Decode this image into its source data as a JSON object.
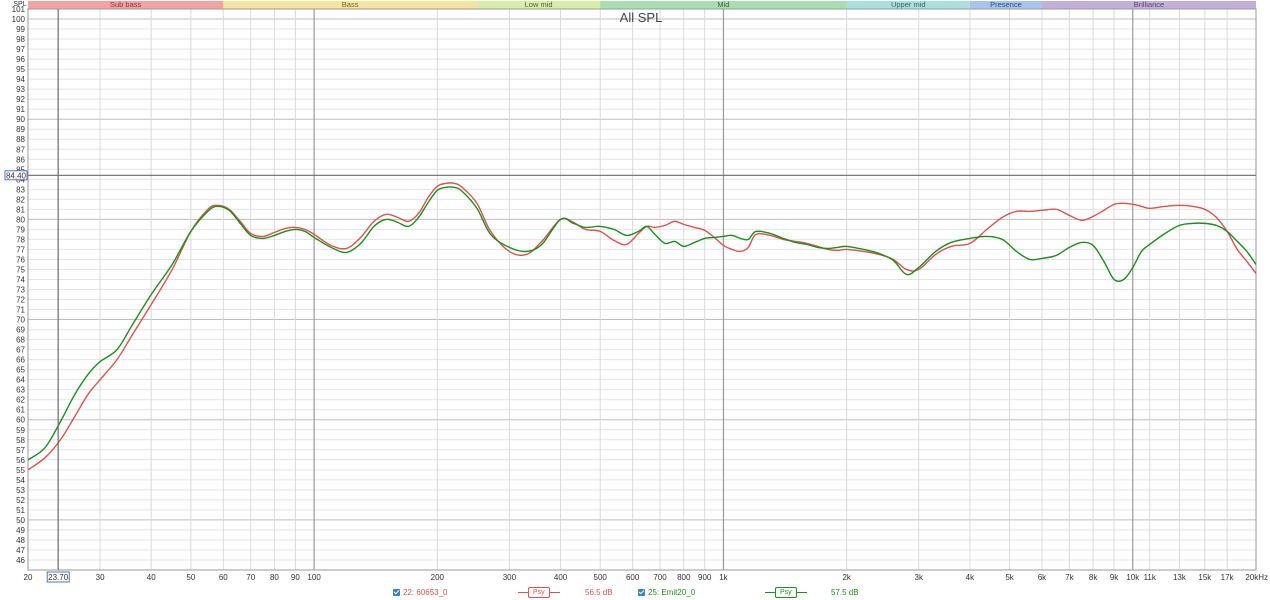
{
  "chart_data": {
    "type": "line",
    "title": "All SPL",
    "ylabel": "SPL",
    "xscale": "log",
    "xlim": [
      20,
      20000
    ],
    "ylim": [
      45,
      101
    ],
    "y_ticks": [
      46,
      47,
      48,
      49,
      50,
      51,
      52,
      53,
      54,
      55,
      56,
      57,
      58,
      59,
      60,
      61,
      62,
      63,
      64,
      65,
      66,
      67,
      68,
      69,
      70,
      71,
      72,
      73,
      74,
      75,
      76,
      77,
      78,
      79,
      80,
      81,
      82,
      83,
      84,
      85,
      86,
      87,
      88,
      89,
      90,
      91,
      92,
      93,
      94,
      95,
      96,
      97,
      98,
      99,
      100,
      101
    ],
    "x_ticks": [
      {
        "v": 20,
        "label": "20"
      },
      {
        "v": 30,
        "label": "30"
      },
      {
        "v": 40,
        "label": "40"
      },
      {
        "v": 50,
        "label": "50"
      },
      {
        "v": 60,
        "label": "60"
      },
      {
        "v": 70,
        "label": "70"
      },
      {
        "v": 80,
        "label": "80"
      },
      {
        "v": 90,
        "label": "90"
      },
      {
        "v": 100,
        "label": "100"
      },
      {
        "v": 200,
        "label": "200"
      },
      {
        "v": 300,
        "label": "300"
      },
      {
        "v": 400,
        "label": "400"
      },
      {
        "v": 500,
        "label": "500"
      },
      {
        "v": 600,
        "label": "600"
      },
      {
        "v": 700,
        "label": "700"
      },
      {
        "v": 800,
        "label": "800"
      },
      {
        "v": 900,
        "label": "900"
      },
      {
        "v": 1000,
        "label": "1k"
      },
      {
        "v": 2000,
        "label": "2k"
      },
      {
        "v": 3000,
        "label": "3k"
      },
      {
        "v": 4000,
        "label": "4k"
      },
      {
        "v": 5000,
        "label": "5k"
      },
      {
        "v": 6000,
        "label": "6k"
      },
      {
        "v": 7000,
        "label": "7k"
      },
      {
        "v": 8000,
        "label": "8k"
      },
      {
        "v": 9000,
        "label": "9k"
      },
      {
        "v": 10000,
        "label": "10k"
      },
      {
        "v": 11000,
        "label": "11k"
      },
      {
        "v": 13000,
        "label": "13k"
      },
      {
        "v": 15000,
        "label": "15k"
      },
      {
        "v": 17000,
        "label": "17k"
      },
      {
        "v": 20000,
        "label": "20kHz"
      }
    ],
    "bands": [
      {
        "name": "Sub bass",
        "from": 20,
        "to": 60,
        "color": "#f4a3a3",
        "text": "#9b3030"
      },
      {
        "name": "Bass",
        "from": 60,
        "to": 250,
        "color": "#f5e3a0",
        "text": "#7a6414"
      },
      {
        "name": "Low mid",
        "from": 250,
        "to": 500,
        "color": "#d6eeaa",
        "text": "#4b6a1e"
      },
      {
        "name": "Mid",
        "from": 500,
        "to": 2000,
        "color": "#a9deb0",
        "text": "#2d6a3a"
      },
      {
        "name": "Upper mid",
        "from": 2000,
        "to": 4000,
        "color": "#a9e0dc",
        "text": "#2a6a68"
      },
      {
        "name": "Presence",
        "from": 4000,
        "to": 6000,
        "color": "#a9c4ea",
        "text": "#2c4d7e"
      },
      {
        "name": "Brilliance",
        "from": 6000,
        "to": 20000,
        "color": "#c3b0d9",
        "text": "#54407a"
      }
    ],
    "cursor": {
      "x": 23.7,
      "y": 84.4,
      "x_label": "23.70",
      "y_label": "84.40"
    },
    "series": [
      {
        "name": "22: 60653_0",
        "color": "#d9534f",
        "x": [
          20,
          22,
          24,
          26,
          28,
          30,
          33,
          36,
          40,
          45,
          50,
          55,
          58,
          62,
          66,
          70,
          75,
          80,
          85,
          90,
          95,
          100,
          110,
          120,
          130,
          140,
          150,
          160,
          170,
          180,
          190,
          200,
          210,
          220,
          230,
          250,
          270,
          300,
          330,
          360,
          400,
          430,
          460,
          500,
          540,
          580,
          620,
          650,
          680,
          720,
          760,
          800,
          850,
          900,
          950,
          1000,
          1050,
          1100,
          1150,
          1200,
          1300,
          1400,
          1500,
          1600,
          1700,
          1800,
          1900,
          2000,
          2200,
          2400,
          2600,
          2800,
          3000,
          3300,
          3600,
          4000,
          4400,
          4800,
          5200,
          5600,
          6000,
          6500,
          7000,
          7500,
          8000,
          8500,
          9000,
          9500,
          10000,
          10500,
          11000,
          12000,
          13000,
          14000,
          15000,
          16000,
          17000,
          18000,
          19000,
          20000
        ],
        "y": [
          55.0,
          56.2,
          58.0,
          60.3,
          62.5,
          64.0,
          66.0,
          68.5,
          71.5,
          75.0,
          78.8,
          81.0,
          81.4,
          81.0,
          79.8,
          78.6,
          78.3,
          78.7,
          79.1,
          79.2,
          79.0,
          78.5,
          77.4,
          77.1,
          78.2,
          79.8,
          80.5,
          80.2,
          79.8,
          80.6,
          82.2,
          83.3,
          83.6,
          83.6,
          83.2,
          81.6,
          78.8,
          76.8,
          76.5,
          77.8,
          80.0,
          79.7,
          79.0,
          78.8,
          77.9,
          77.5,
          78.6,
          79.3,
          79.2,
          79.4,
          79.8,
          79.5,
          79.2,
          78.9,
          78.2,
          77.4,
          77.0,
          76.8,
          77.2,
          78.5,
          78.4,
          78.0,
          77.8,
          77.6,
          77.3,
          77.0,
          76.9,
          77.0,
          76.8,
          76.5,
          76.0,
          75.0,
          75.0,
          76.5,
          77.3,
          77.6,
          79.0,
          80.2,
          80.8,
          80.8,
          80.9,
          81.0,
          80.4,
          79.9,
          80.3,
          80.9,
          81.5,
          81.6,
          81.5,
          81.3,
          81.1,
          81.3,
          81.4,
          81.3,
          81.0,
          80.2,
          78.8,
          77.0,
          75.8,
          74.6
        ]
      },
      {
        "name": "25: Emit20_0",
        "color": "#1e8c1e",
        "x": [
          20,
          22,
          24,
          26,
          28,
          30,
          33,
          36,
          40,
          45,
          50,
          55,
          58,
          62,
          66,
          70,
          75,
          80,
          85,
          90,
          95,
          100,
          110,
          120,
          130,
          140,
          150,
          160,
          170,
          180,
          190,
          200,
          210,
          220,
          230,
          250,
          270,
          300,
          330,
          360,
          400,
          430,
          460,
          500,
          540,
          580,
          620,
          650,
          680,
          720,
          760,
          800,
          850,
          900,
          950,
          1000,
          1050,
          1100,
          1150,
          1200,
          1300,
          1400,
          1500,
          1600,
          1700,
          1800,
          1900,
          2000,
          2200,
          2400,
          2600,
          2800,
          3000,
          3300,
          3600,
          4000,
          4400,
          4800,
          5200,
          5600,
          6000,
          6500,
          7000,
          7500,
          8000,
          8500,
          9000,
          9500,
          10000,
          10500,
          11000,
          12000,
          13000,
          14000,
          15000,
          16000,
          17000,
          18000,
          19000,
          20000
        ],
        "y": [
          56.0,
          57.2,
          59.8,
          62.5,
          64.5,
          65.8,
          67.0,
          69.5,
          72.5,
          75.5,
          78.8,
          80.8,
          81.3,
          80.9,
          79.6,
          78.4,
          78.1,
          78.4,
          78.8,
          79.0,
          78.8,
          78.2,
          77.2,
          76.7,
          77.6,
          79.3,
          80.0,
          79.7,
          79.3,
          80.2,
          81.7,
          82.9,
          83.2,
          83.2,
          82.8,
          81.1,
          78.5,
          77.2,
          76.8,
          77.5,
          80.0,
          79.6,
          79.2,
          79.3,
          79.0,
          78.4,
          78.8,
          79.3,
          78.5,
          77.6,
          77.8,
          77.3,
          77.7,
          78.1,
          78.2,
          78.3,
          78.4,
          78.1,
          78.0,
          78.8,
          78.6,
          78.1,
          77.7,
          77.5,
          77.2,
          77.1,
          77.2,
          77.3,
          77.0,
          76.6,
          75.9,
          74.5,
          75.2,
          76.8,
          77.7,
          78.1,
          78.3,
          78.0,
          76.8,
          76.0,
          76.1,
          76.4,
          77.2,
          77.7,
          77.4,
          75.8,
          74.0,
          74.0,
          75.2,
          76.8,
          77.5,
          78.6,
          79.4,
          79.6,
          79.6,
          79.4,
          78.8,
          77.8,
          76.8,
          75.5
        ]
      }
    ],
    "legend": [
      {
        "name": "22: 60653_0",
        "smoothing": "Psy",
        "level": "56.5 dB",
        "color": "#d9534f"
      },
      {
        "name": "25: Emit20_0",
        "smoothing": "Psy",
        "level": "57.5 dB",
        "color": "#1e8c1e"
      }
    ]
  }
}
